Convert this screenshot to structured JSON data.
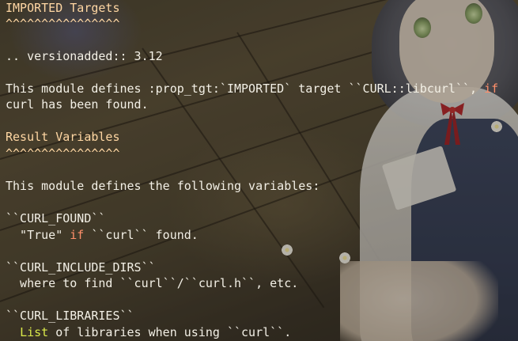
{
  "terminal": {
    "lines": [
      {
        "text": "IMPORTED Targets"
      },
      {
        "text": "^^^^^^^^^^^^^^^^"
      },
      {
        "text": ""
      },
      {
        "text": ".. versionadded:: 3.12"
      },
      {
        "text": ""
      },
      {
        "prefix": "This module defines :prop_tgt:`IMPORTED` target ``CURL::libcurl``, ",
        "keyword": "if"
      },
      {
        "text": "curl has been found."
      },
      {
        "text": ""
      },
      {
        "text": "Result Variables"
      },
      {
        "text": "^^^^^^^^^^^^^^^^"
      },
      {
        "text": ""
      },
      {
        "text": "This module defines the following variables:"
      },
      {
        "text": ""
      },
      {
        "text": "``CURL_FOUND``"
      },
      {
        "prefix": "  \"True\" ",
        "keyword": "if",
        "suffix": " ``curl`` found."
      },
      {
        "text": ""
      },
      {
        "text": "``CURL_INCLUDE_DIRS``"
      },
      {
        "text": "  where to find ``curl``/``curl.h``, etc."
      },
      {
        "text": ""
      },
      {
        "text": "``CURL_LIBRARIES``"
      },
      {
        "prefix": "  ",
        "keyword": "List",
        "suffix": " of libraries when using ``curl``."
      }
    ]
  },
  "colors": {
    "text": "#f3f0e6",
    "keyword_red": "#ff8f6a",
    "keyword_green": "#d9e84a"
  }
}
